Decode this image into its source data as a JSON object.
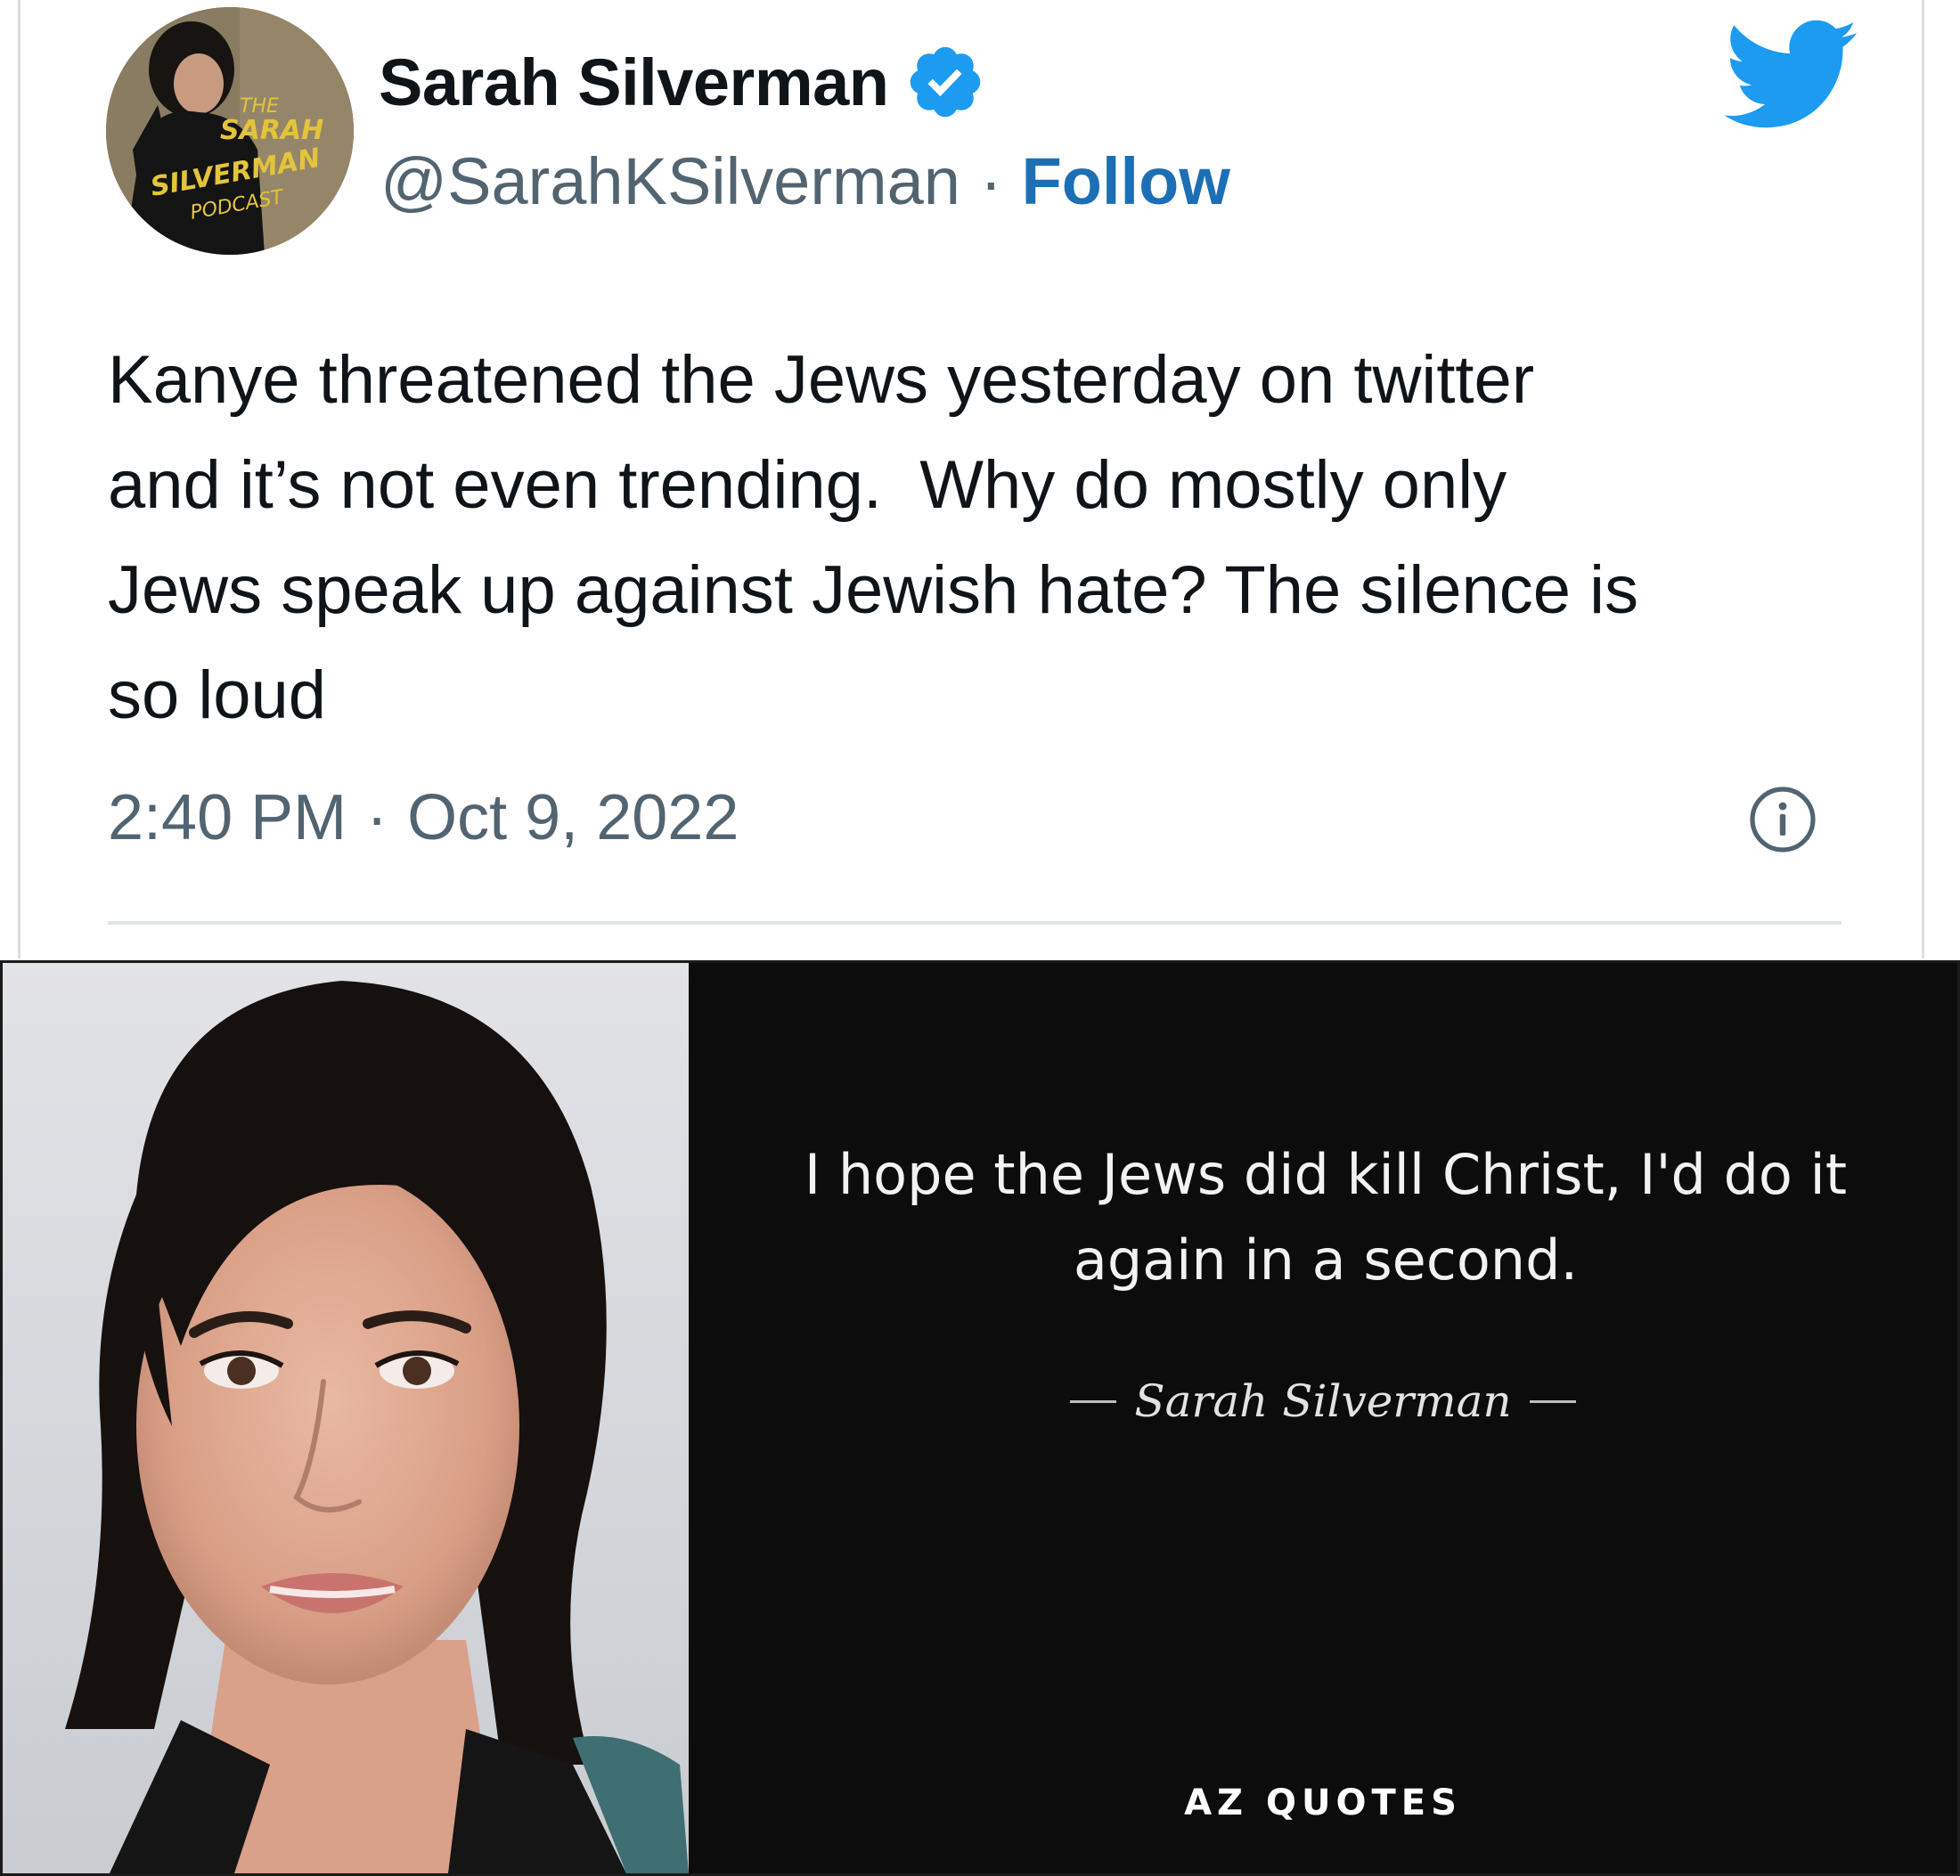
{
  "tweet": {
    "display_name": "Sarah Silverman",
    "verified": true,
    "handle": "@SarahKSilverman",
    "separator": "·",
    "follow_label": "Follow",
    "text": "Kanye threatened the Jews yesterday on twitter\nand it’s not even trending.  Why do mostly only\nJews speak up against Jewish hate? The silence is\nso loud",
    "time": "2:40 PM",
    "date": "Oct 9, 2022",
    "avatar_text": [
      "THE",
      "SARAH",
      "SILVERMAN",
      "PODCAST"
    ],
    "colors": {
      "accent": "#1d9bf0",
      "follow": "#1d6fb5",
      "secondary_text": "#536471",
      "avatar_text": "#e3c43a"
    },
    "icons": {
      "verified": "verified-badge-icon",
      "logo": "twitter-bird-icon",
      "info": "info-icon"
    }
  },
  "quote_card": {
    "quote": "I hope the Jews did kill Christ, I'd do it again in a second.",
    "author": "Sarah Silverman",
    "brand": "AZ QUOTES",
    "colors": {
      "background": "#0c0c0c",
      "text": "#f2f2f2"
    }
  }
}
